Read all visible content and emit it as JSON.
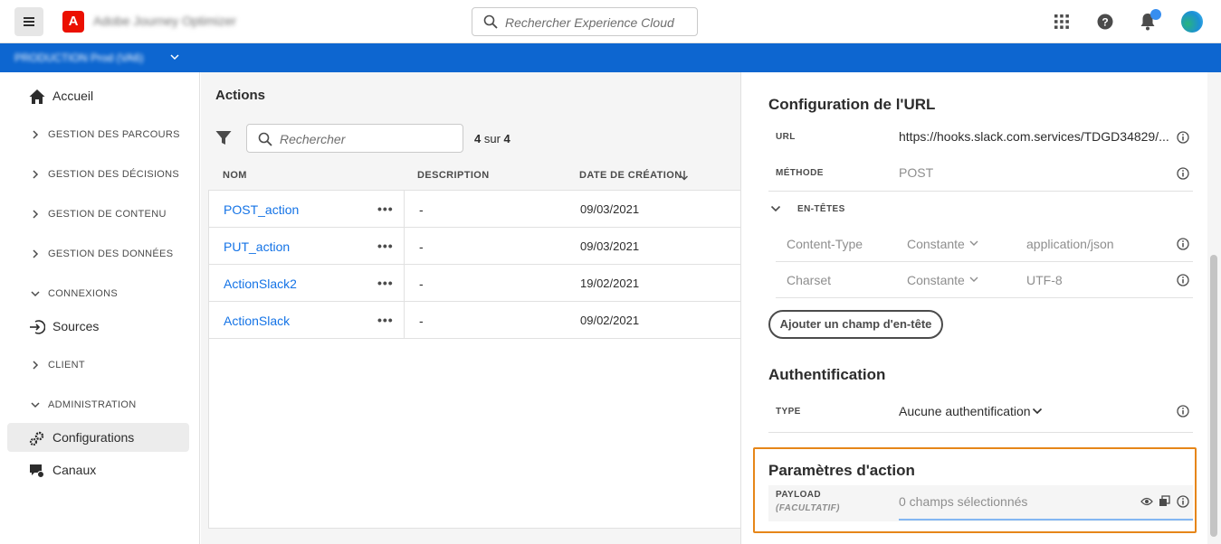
{
  "topbar": {
    "app_title": "Adobe Journey Optimizer",
    "search_placeholder": "Rechercher Experience Cloud"
  },
  "envbar": {
    "label": "PRODUCTION  Prod (VA6)"
  },
  "sidebar": {
    "home": "Accueil",
    "sections": [
      {
        "label": "GESTION DES PARCOURS",
        "expanded": false
      },
      {
        "label": "GESTION DES DÉCISIONS",
        "expanded": false
      },
      {
        "label": "GESTION DE CONTENU",
        "expanded": false
      },
      {
        "label": "GESTION DES DONNÉES",
        "expanded": false
      },
      {
        "label": "CONNEXIONS",
        "expanded": true
      },
      {
        "label": "CLIENT",
        "expanded": false
      },
      {
        "label": "ADMINISTRATION",
        "expanded": true
      }
    ],
    "sources": "Sources",
    "configurations": "Configurations",
    "channels": "Canaux"
  },
  "main": {
    "title": "Actions",
    "search_placeholder": "Rechercher",
    "count_shown": "4",
    "count_sep": "sur",
    "count_total": "4",
    "columns": {
      "name": "NOM",
      "description": "DESCRIPTION",
      "created": "DATE DE CRÉATION"
    },
    "rows": [
      {
        "name": "POST_action",
        "description": "-",
        "created": "09/03/2021"
      },
      {
        "name": "PUT_action",
        "description": "-",
        "created": "09/03/2021"
      },
      {
        "name": "ActionSlack2",
        "description": "-",
        "created": "19/02/2021"
      },
      {
        "name": "ActionSlack",
        "description": "-",
        "created": "09/02/2021"
      }
    ]
  },
  "panel": {
    "url_section": "Configuration de l'URL",
    "url_label": "URL",
    "url_value": "https://hooks.slack.com.services/TDGD34829/...",
    "method_label": "MÉTHODE",
    "method_value": "POST",
    "headers_label": "EN-TÊTES",
    "headers": [
      {
        "key": "Content-Type",
        "type": "Constante",
        "value": "application/json"
      },
      {
        "key": "Charset",
        "type": "Constante",
        "value": "UTF-8"
      }
    ],
    "add_header_button": "Ajouter un champ d'en-tête",
    "auth_section": "Authentification",
    "auth_type_label": "TYPE",
    "auth_type_value": "Aucune authentification",
    "params_section": "Paramètres d'action",
    "payload_label": "PAYLOAD",
    "payload_optional": "(FACULTATIF)",
    "payload_value": "0 champs sélectionnés"
  },
  "colors": {
    "accent": "#0d66d0",
    "link": "#1473e6",
    "highlight": "#e68619"
  }
}
